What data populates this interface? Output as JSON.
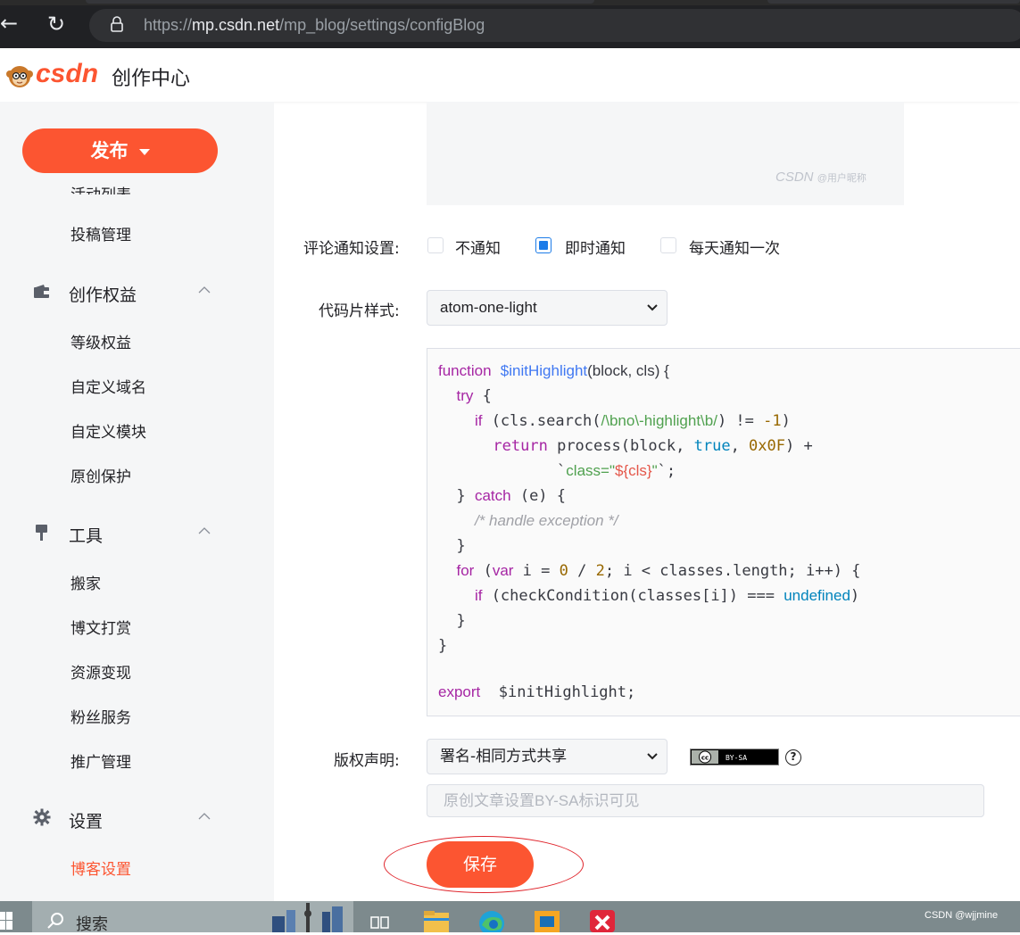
{
  "browser": {
    "url_scheme": "https://",
    "url_host": "mp.csdn.net",
    "url_path": "/mp_blog/settings/configBlog"
  },
  "header": {
    "logo_text": "csdn",
    "title": "创作中心"
  },
  "sidebar": {
    "publish_label": "发布",
    "cut_top_item": "活动列表",
    "items_a": [
      "投稿管理"
    ],
    "group_rights": {
      "label": "创作权益",
      "items": [
        "等级权益",
        "自定义域名",
        "自定义模块",
        "原创保护"
      ]
    },
    "group_tools": {
      "label": "工具",
      "items": [
        "搬家",
        "博文打赏",
        "资源变现",
        "粉丝服务",
        "推广管理"
      ]
    },
    "group_settings": {
      "label": "设置",
      "items": [
        "博客设置"
      ]
    }
  },
  "preview": {
    "watermark_brand": "CSDN",
    "watermark_user": "@用户昵称"
  },
  "comment_notify": {
    "label": "评论通知设置:",
    "options": [
      "不通知",
      "即时通知",
      "每天通知一次"
    ],
    "selected": "即时通知"
  },
  "code_style": {
    "label": "代码片样式:",
    "value": "atom-one-light"
  },
  "copyright": {
    "label": "版权声明:",
    "value": "署名-相同方式共享",
    "badge_text": "BY-SA",
    "help_symbol": "?",
    "input_placeholder": "原创文章设置BY-SA标识可见"
  },
  "save_label": "保存",
  "taskbar": {
    "search_placeholder": "搜索",
    "watermark": "CSDN @wjjmine"
  },
  "colors": {
    "brand": "#fc5531",
    "checkbox_active": "#1d7ce8"
  }
}
